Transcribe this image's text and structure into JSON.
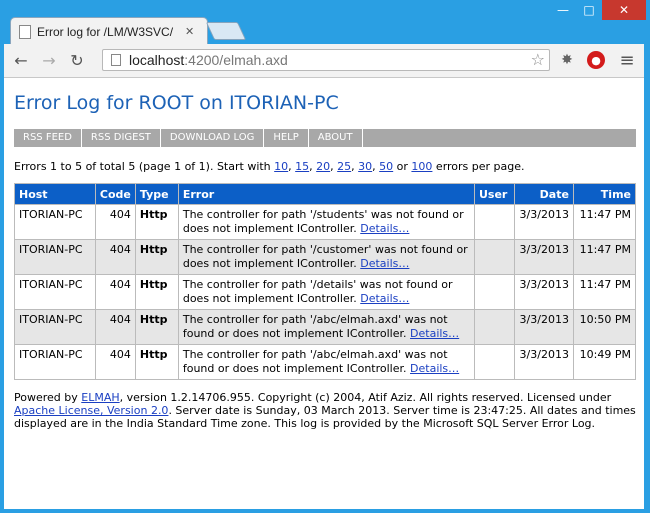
{
  "browser": {
    "tab_title": "Error log for /LM/W3SVC/",
    "url_host": "localhost",
    "url_rest": ":4200/elmah.axd"
  },
  "page": {
    "heading": "Error Log for ROOT on ITORIAN-PC",
    "nav": [
      "RSS FEED",
      "RSS DIGEST",
      "DOWNLOAD LOG",
      "HELP",
      "ABOUT"
    ],
    "stats_prefix": "Errors 1 to 5 of total 5 (page 1 of 1). Start with",
    "page_sizes": [
      "10",
      "15",
      "20",
      "25",
      "30",
      "50",
      "100"
    ],
    "stats_suffix": "errors per page.",
    "columns": [
      "Host",
      "Code",
      "Type",
      "Error",
      "User",
      "Date",
      "Time"
    ],
    "details_label": "Details…",
    "rows": [
      {
        "host": "ITORIAN-PC",
        "code": "404",
        "type": "Http",
        "error": "The controller for path '/students' was not found or does not implement IController.",
        "user": "",
        "date": "3/3/2013",
        "time": "11:47 PM"
      },
      {
        "host": "ITORIAN-PC",
        "code": "404",
        "type": "Http",
        "error": "The controller for path '/customer' was not found or does not implement IController.",
        "user": "",
        "date": "3/3/2013",
        "time": "11:47 PM"
      },
      {
        "host": "ITORIAN-PC",
        "code": "404",
        "type": "Http",
        "error": "The controller for path '/details' was not found or does not implement IController.",
        "user": "",
        "date": "3/3/2013",
        "time": "11:47 PM"
      },
      {
        "host": "ITORIAN-PC",
        "code": "404",
        "type": "Http",
        "error": "The controller for path '/abc/elmah.axd' was not found or does not implement IController.",
        "user": "",
        "date": "3/3/2013",
        "time": "10:50 PM"
      },
      {
        "host": "ITORIAN-PC",
        "code": "404",
        "type": "Http",
        "error": "The controller for path '/abc/elmah.axd' was not found or does not implement IController.",
        "user": "",
        "date": "3/3/2013",
        "time": "10:49 PM"
      }
    ],
    "footer": {
      "powered_by": "Powered by",
      "elmah_link": "ELMAH",
      "after_elmah": ", version 1.2.14706.955. Copyright (c) 2004, Atif Aziz. All rights reserved. Licensed under",
      "license_link": "Apache License, Version 2.0",
      "rest": ". Server date is Sunday, 03 March 2013. Server time is 23:47:25. All dates and times displayed are in the India Standard Time zone. This log is provided by the Microsoft SQL Server Error Log."
    }
  },
  "colors": {
    "heading": "#1d62b6",
    "table_header": "#0c5fc7",
    "navbar": "#a8a8a8",
    "link": "#1a3fc2"
  }
}
